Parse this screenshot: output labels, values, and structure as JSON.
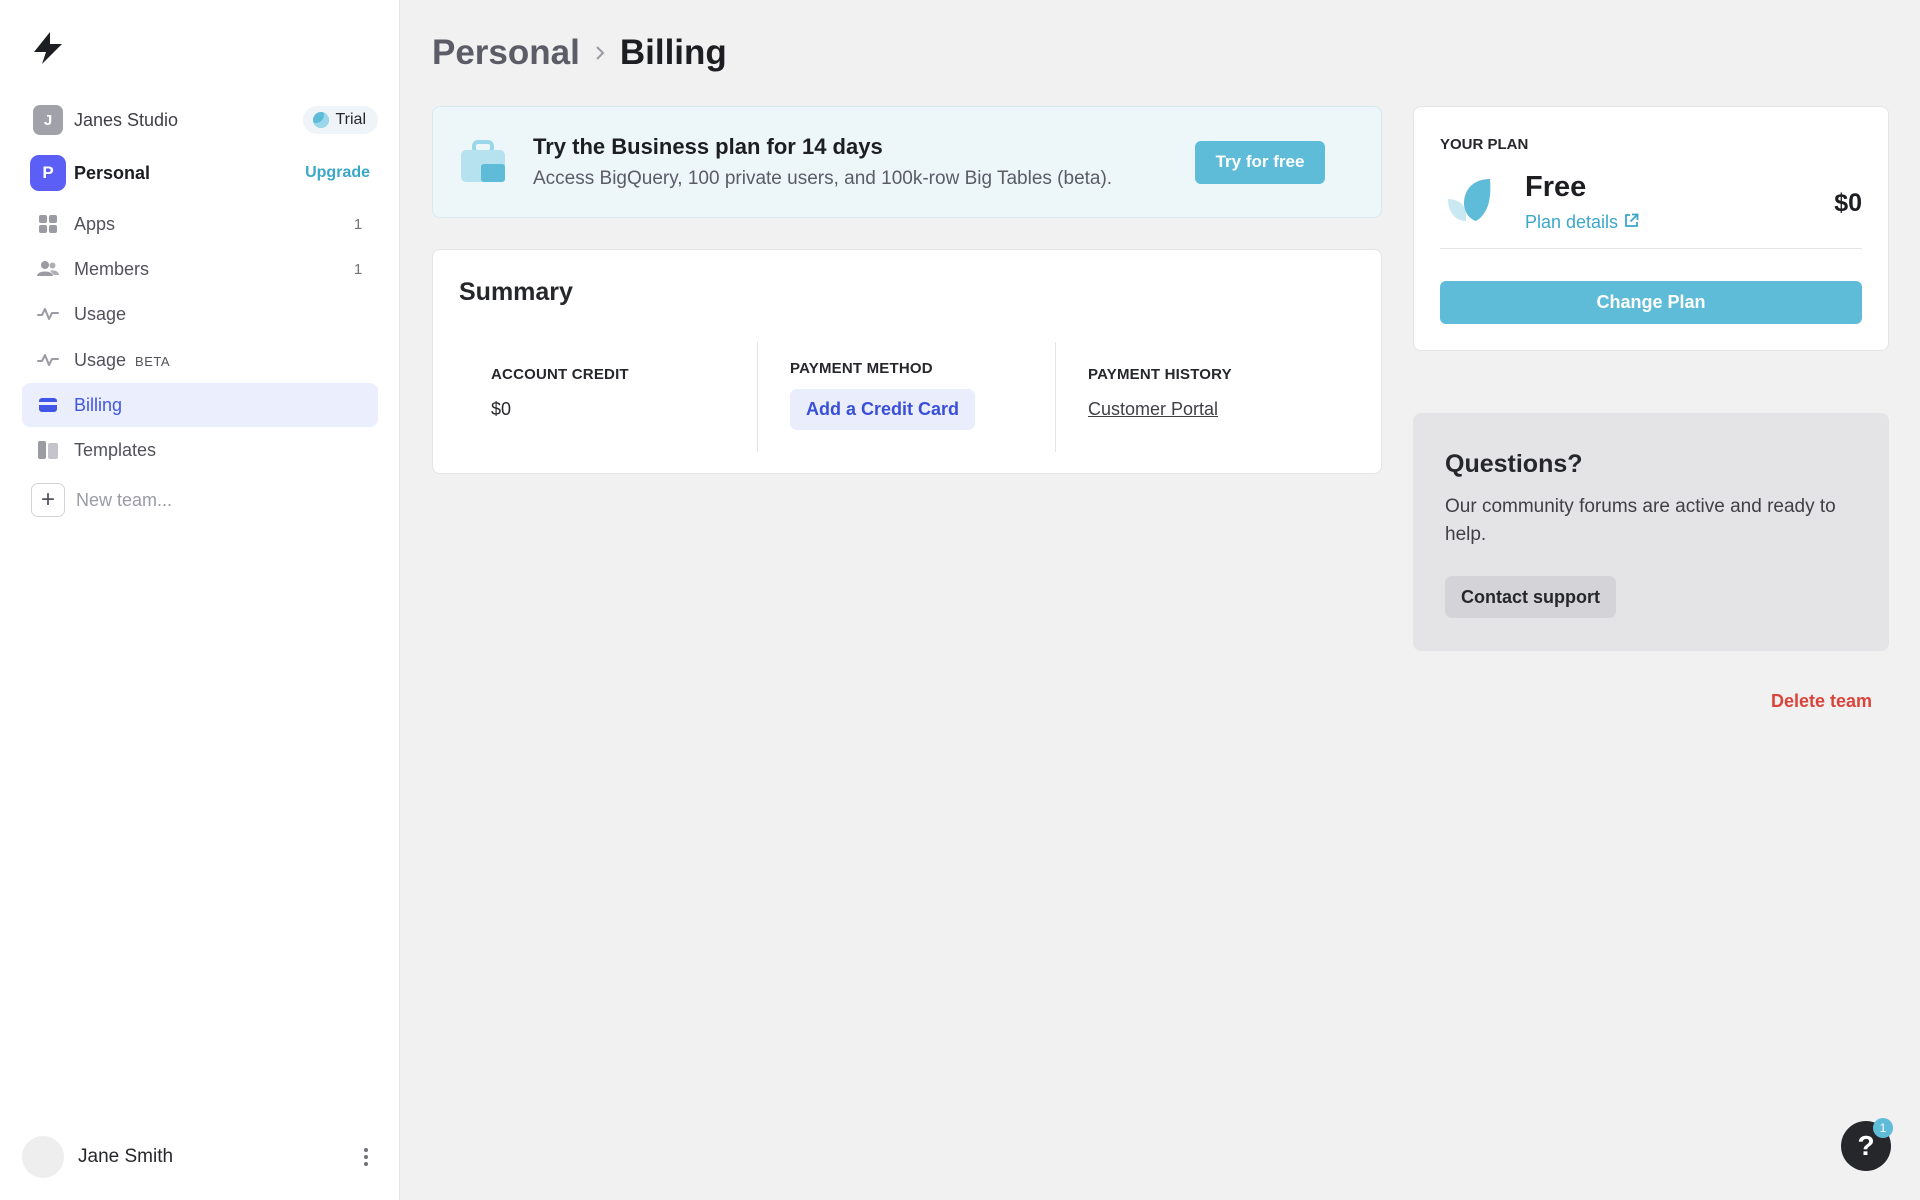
{
  "sidebar": {
    "teams": [
      {
        "initial": "J",
        "name": "Janes Studio",
        "badge": "Trial",
        "avatar_color": "#a1a1aa"
      },
      {
        "initial": "P",
        "name": "Personal",
        "action": "Upgrade",
        "avatar_color": "#5b5ff6"
      }
    ],
    "nav": [
      {
        "label": "Apps",
        "count": "1",
        "icon": "apps-grid-icon"
      },
      {
        "label": "Members",
        "count": "1",
        "icon": "members-icon"
      },
      {
        "label": "Usage",
        "icon": "activity-icon"
      },
      {
        "label": "Usage",
        "suffix": "BETA",
        "icon": "activity-icon"
      },
      {
        "label": "Billing",
        "icon": "credit-card-icon",
        "active": true
      },
      {
        "label": "Templates",
        "icon": "templates-icon"
      }
    ],
    "new_team_label": "New team...",
    "user_name": "Jane Smith"
  },
  "breadcrumb": {
    "parent": "Personal",
    "current": "Billing"
  },
  "banner": {
    "title": "Try the Business plan for 14 days",
    "subtitle": "Access BigQuery, 100 private users, and 100k-row Big Tables (beta).",
    "button": "Try for free"
  },
  "summary": {
    "title": "Summary",
    "account_credit_label": "ACCOUNT CREDIT",
    "account_credit_value": "$0",
    "payment_method_label": "PAYMENT METHOD",
    "payment_method_button": "Add a Credit Card",
    "payment_history_label": "PAYMENT HISTORY",
    "payment_history_link": "Customer Portal"
  },
  "plan": {
    "eyebrow": "YOUR PLAN",
    "name": "Free",
    "details_link": "Plan details",
    "price": "$0",
    "change_button": "Change Plan"
  },
  "questions": {
    "title": "Questions?",
    "body": "Our community forums are active and ready to help.",
    "button": "Contact support"
  },
  "delete_team": "Delete team",
  "help": {
    "glyph": "?",
    "badge_count": "1"
  },
  "colors": {
    "accent": "#5ebcd9",
    "active_nav": "#4156e6",
    "danger": "#d9453a"
  }
}
